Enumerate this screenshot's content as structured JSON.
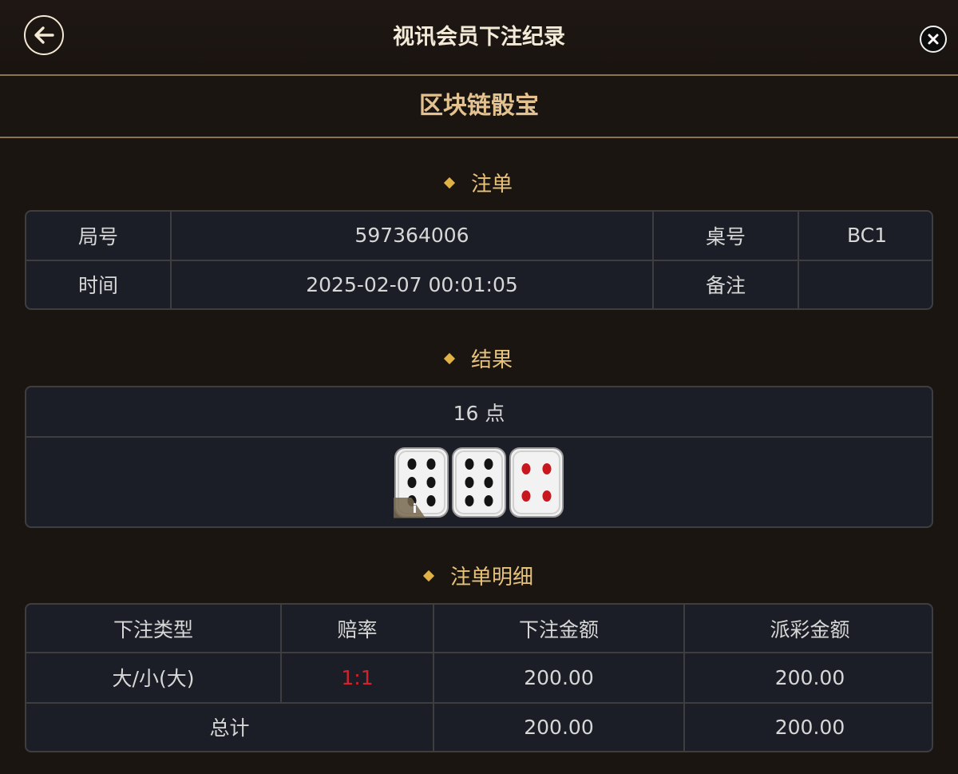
{
  "header": {
    "title": "视讯会员下注纪录"
  },
  "subheader": {
    "game_name": "区块链骰宝"
  },
  "sections": {
    "order": "注单",
    "result": "结果",
    "detail": "注单明细"
  },
  "order": {
    "round_label": "局号",
    "round_value": "597364006",
    "table_label": "桌号",
    "table_value": "BC1",
    "time_label": "时间",
    "time_value": "2025-02-07 00:01:05",
    "remark_label": "备注",
    "remark_value": ""
  },
  "result": {
    "points": "16 点",
    "dice": [
      6,
      6,
      4
    ],
    "info_label": "i"
  },
  "detail": {
    "headers": [
      "下注类型",
      "赔率",
      "下注金额",
      "派彩金额"
    ],
    "rows": [
      {
        "bet_type": "大/小(大)",
        "odds": "1:1",
        "bet_amount": "200.00",
        "payout": "200.00"
      }
    ],
    "total_label": "总计",
    "total_bet": "200.00",
    "total_payout": "200.00"
  },
  "colors": {
    "accent_gold": "#e7c27a",
    "title_gold": "#e3c28f",
    "odds_red": "#d2222d",
    "panel_bg": "#1b1e26",
    "page_bg": "#1b1512"
  }
}
